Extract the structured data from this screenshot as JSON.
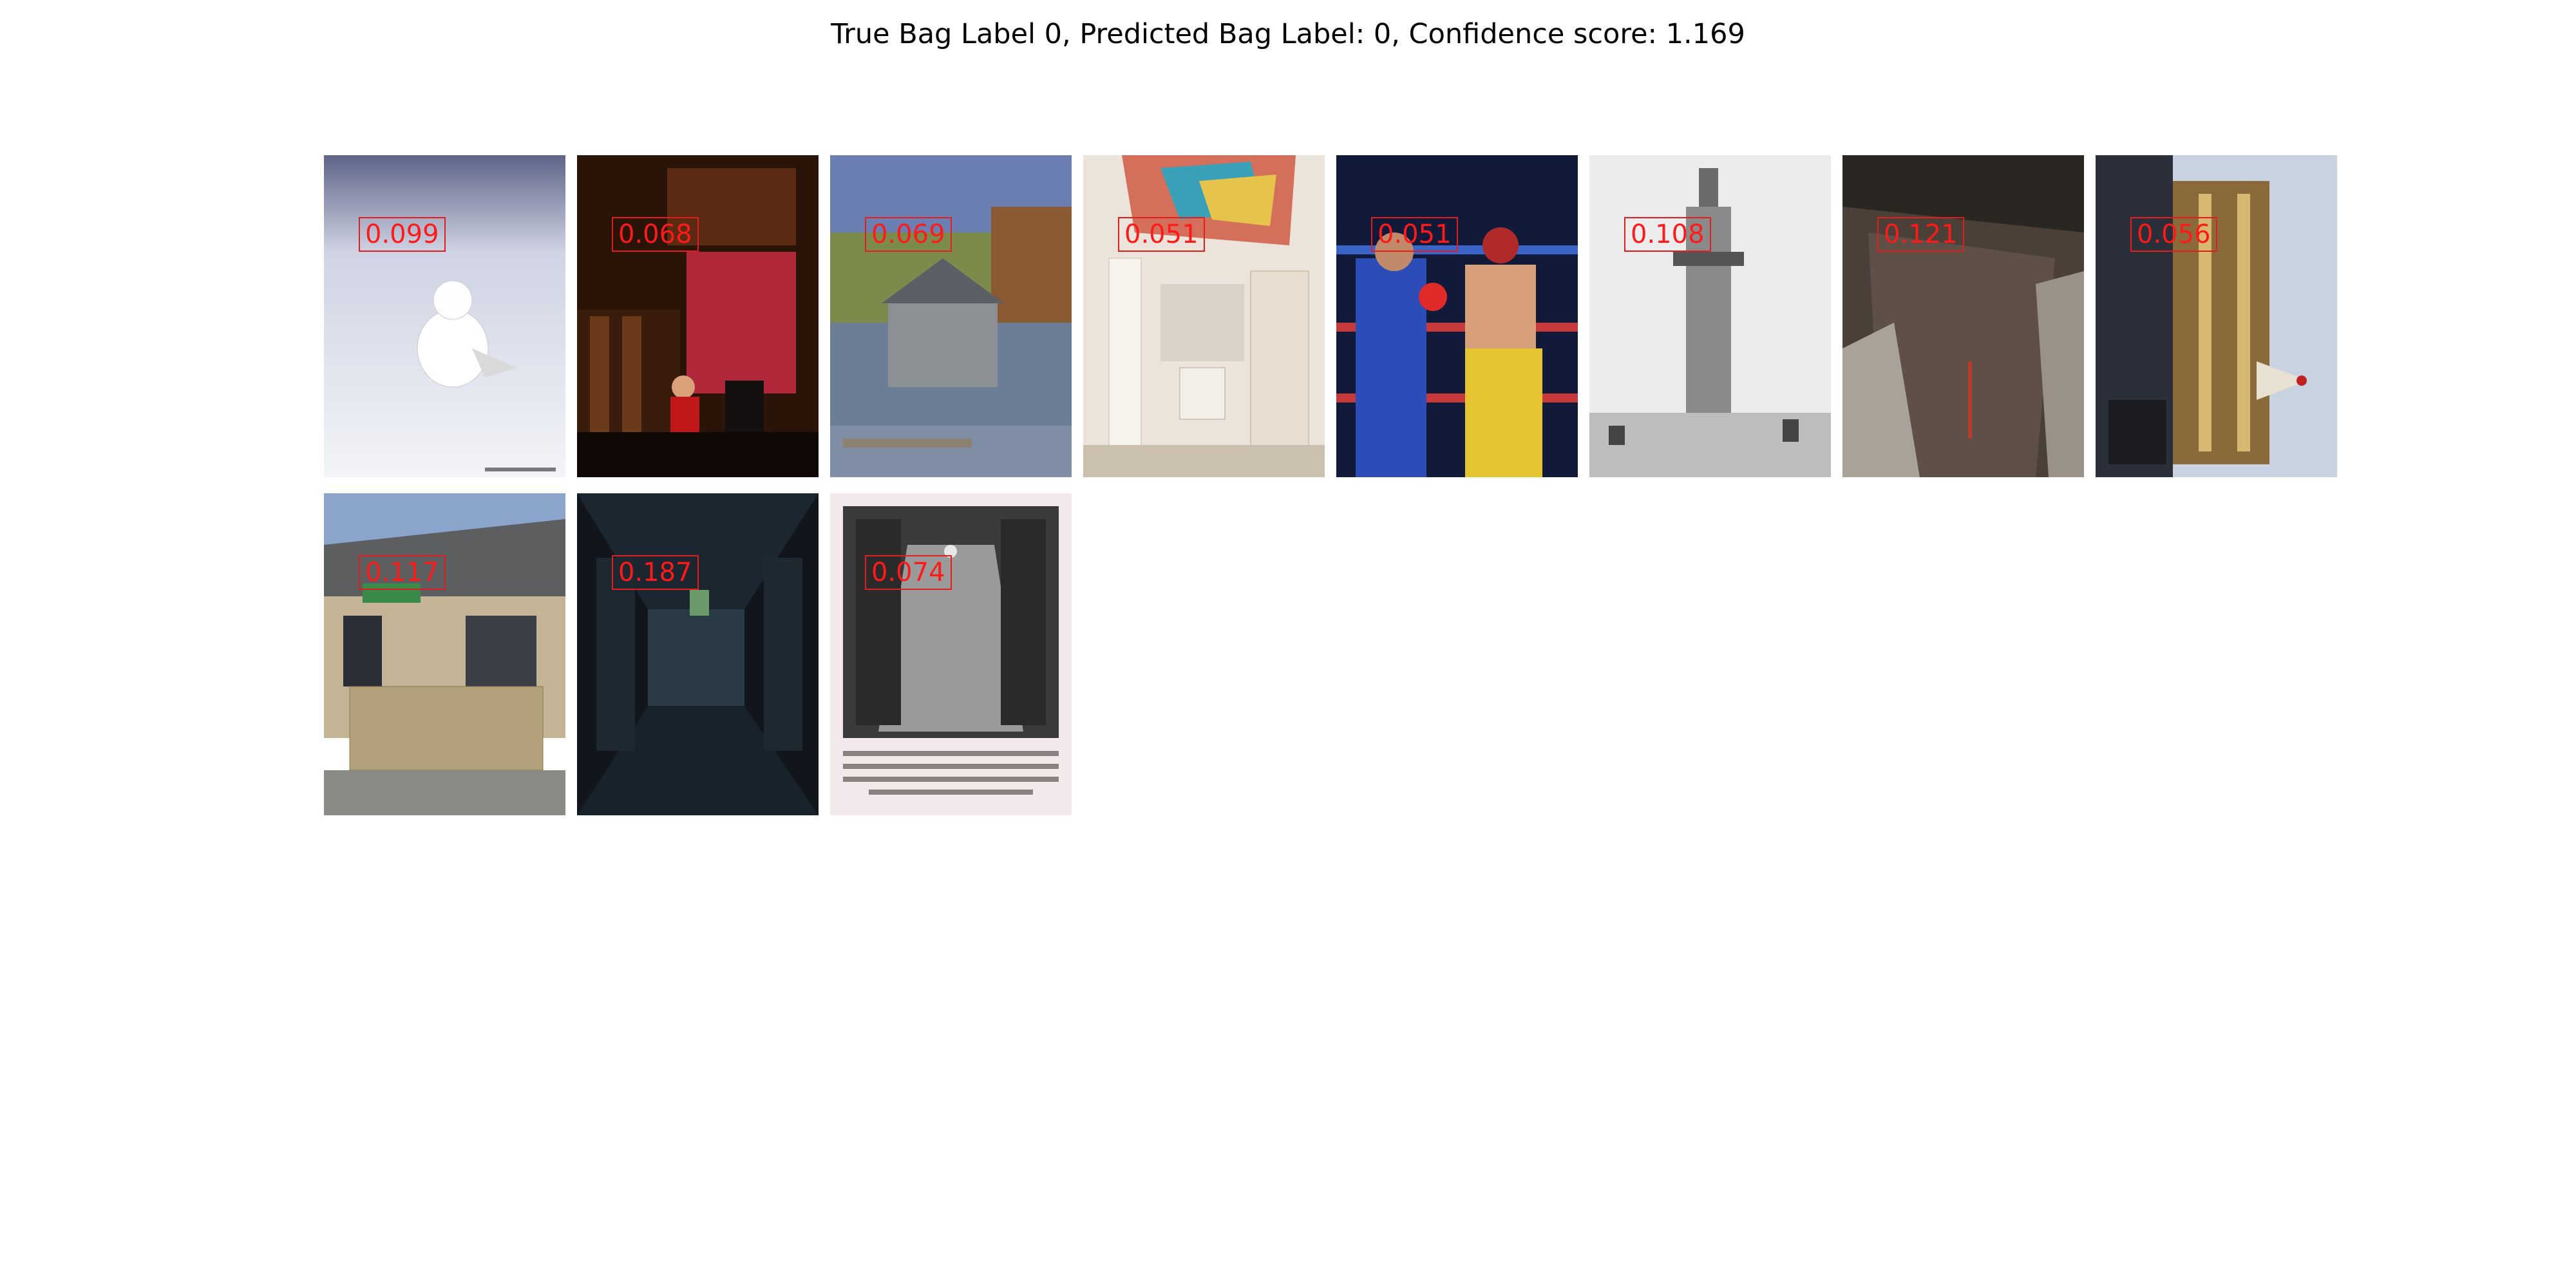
{
  "title": "True Bag Label 0, Predicted Bag Label: 0, Confidence score: 1.169",
  "instances": [
    {
      "score": "0.099",
      "subject": "snowy owl on snow"
    },
    {
      "score": "0.068",
      "subject": "person reading in red room"
    },
    {
      "score": "0.069",
      "subject": "stone boathouse on lake"
    },
    {
      "score": "0.051",
      "subject": "bedroom loft with desk"
    },
    {
      "score": "0.051",
      "subject": "boxing match in ring"
    },
    {
      "score": "0.108",
      "subject": "lighthouse engraving"
    },
    {
      "score": "0.121",
      "subject": "ruined wooden structure"
    },
    {
      "score": "0.056",
      "subject": "carousel rotated"
    },
    {
      "score": "0.117",
      "subject": "house with patio"
    },
    {
      "score": "0.187",
      "subject": "dark industrial tunnel"
    },
    {
      "score": "0.074",
      "subject": "vintage hallway photograph"
    }
  ],
  "colors": {
    "score_text": "#ff1a1a",
    "score_box": "#e11d1d"
  }
}
